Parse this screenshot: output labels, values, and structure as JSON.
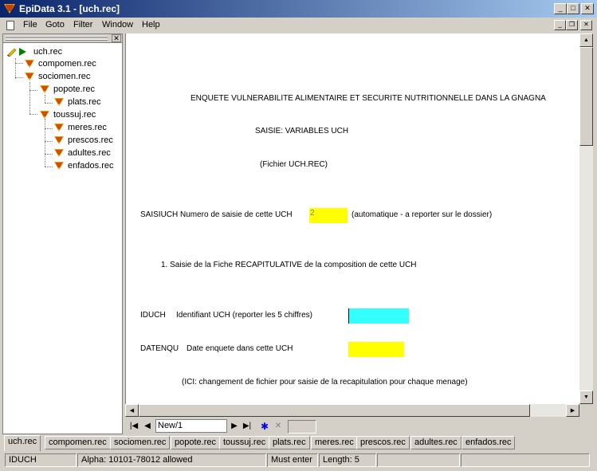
{
  "window": {
    "title": "EpiData 3.1 - [uch.rec]",
    "min_glyph": "_",
    "max_glyph": "□",
    "close_glyph": "✕"
  },
  "menu": {
    "items": [
      "File",
      "Goto",
      "Filter",
      "Window",
      "Help"
    ]
  },
  "mdi": {
    "min_glyph": "_",
    "restore_glyph": "❐",
    "close_glyph": "✕"
  },
  "tree": {
    "close_glyph": "✕",
    "items": [
      {
        "label": "uch.rec"
      },
      {
        "label": "compomen.rec"
      },
      {
        "label": "sociomen.rec"
      },
      {
        "label": "popote.rec"
      },
      {
        "label": "plats.rec"
      },
      {
        "label": "toussuj.rec"
      },
      {
        "label": "meres.rec"
      },
      {
        "label": "prescos.rec"
      },
      {
        "label": "adultes.rec"
      },
      {
        "label": "enfados.rec"
      }
    ]
  },
  "form": {
    "line1": "ENQUETE VULNERABILITE ALIMENTAIRE ET SECURITE NUTRITIONNELLE DANS LA GNAGNA",
    "line2": "SAISIE: VARIABLES UCH",
    "line3": "(Fichier UCH.REC)",
    "saisiuch": {
      "label": "SAISIUCH  Numero de saisie de cette UCH",
      "value": "2",
      "note": "(automatique - a reporter sur le dossier)"
    },
    "section1": "1. Saisie de la Fiche RECAPITULATIVE de la composition de cette UCH",
    "iduch": {
      "name": "IDUCH",
      "desc": "Identifiant UCH (reporter les 5 chiffres)"
    },
    "datenqu": {
      "name": "DATENQU",
      "desc": "Date enquete dans cette UCH"
    },
    "note": "(ICI: changement de fichier pour saisie de la recapitulation pour chaque menage)"
  },
  "colors": {
    "yellow": "#ffff00",
    "cyan": "#33ffff"
  },
  "scroll": {
    "up_glyph": "▲",
    "down_glyph": "▼",
    "left_glyph": "◀",
    "right_glyph": "▶"
  },
  "navigation": {
    "record": "New/1",
    "first_glyph": "|◀",
    "prev_glyph": "◀",
    "next_glyph": "▶",
    "last_glyph": "▶|",
    "new_glyph": "✱",
    "delete_glyph": "✕"
  },
  "tabs": [
    "uch.rec",
    "compomen.rec",
    "sociomen.rec",
    "popote.rec",
    "toussuj.rec",
    "plats.rec",
    "meres.rec",
    "prescos.rec",
    "adultes.rec",
    "enfados.rec"
  ],
  "status": {
    "field": "IDUCH",
    "type": "Alpha: 10101-78012 allowed",
    "must_enter": "Must enter",
    "length": "Length: 5"
  }
}
